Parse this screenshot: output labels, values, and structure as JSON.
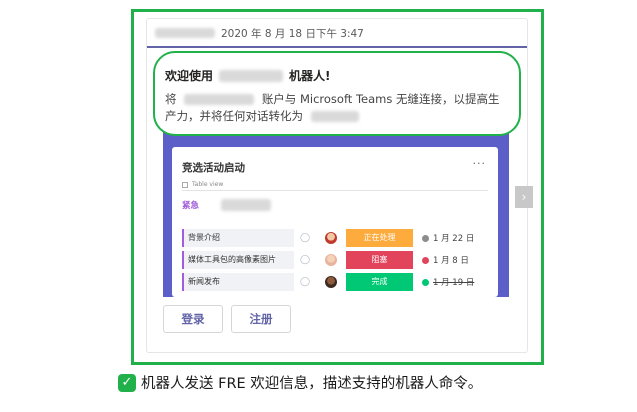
{
  "message": {
    "timestamp": "2020 年 8 月 18 日下午 3:47"
  },
  "welcome": {
    "title_prefix": "欢迎使用",
    "title_suffix": "机器人!",
    "body_prefix": "将",
    "body_text": "账户与 Microsoft Teams 无缝连接，以提高生产力，并将任何对话转化为"
  },
  "card": {
    "title": "竞选活动启动",
    "more": "···",
    "view": "Table view",
    "group_label": "紧急",
    "rows": [
      {
        "name": "背景介绍",
        "status": "正在处理",
        "status_color": "#fdab3d",
        "date": "1 月 22 日",
        "dot_color": "#8c8c8c",
        "done": false
      },
      {
        "name": "媒体工具包的高像素图片",
        "status": "阻塞",
        "status_color": "#e2445c",
        "date": "1 月 8 日",
        "dot_color": "#e2445c",
        "done": false
      },
      {
        "name": "新闻发布",
        "status": "完成",
        "status_color": "#00c875",
        "date": "1 月 19 日",
        "dot_color": "#00c875",
        "done": true
      }
    ]
  },
  "side_arrow": "›",
  "buttons": {
    "login": "登录",
    "register": "注册"
  },
  "caption": {
    "text": "机器人发送 FRE 欢迎信息，描述支持的机器人命令。"
  },
  "colors": {
    "highlight": "#21b14b",
    "accent": "#6264a7",
    "card_background": "#5b5fc7"
  }
}
